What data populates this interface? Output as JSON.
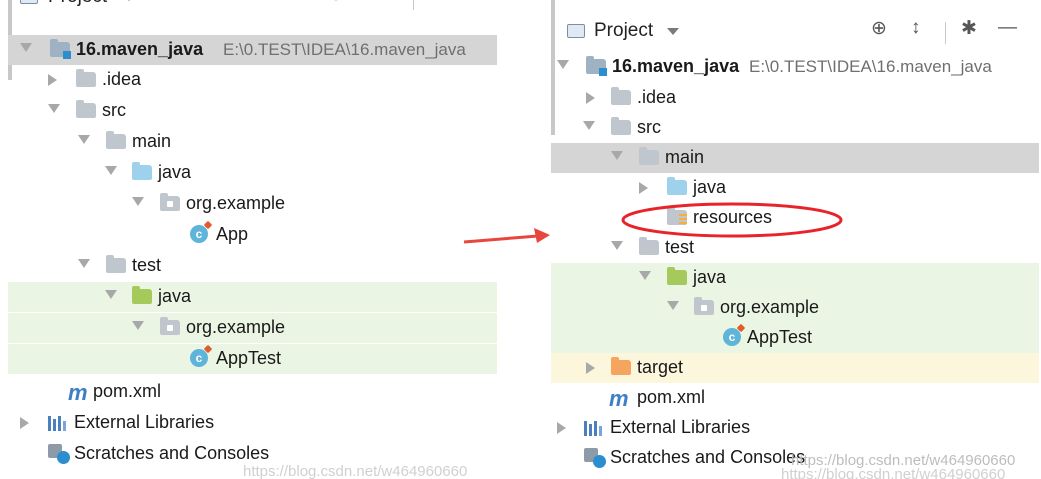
{
  "left_panel": {
    "header_title": "Project",
    "project_name": "16.maven_java",
    "project_path": "E:\\0.TEST\\IDEA\\16.maven_java",
    "items": [
      "16.maven_java",
      ".idea",
      "src",
      "main",
      "java",
      "org.example",
      "App",
      "test",
      "java",
      "org.example",
      "AppTest",
      "pom.xml",
      "External Libraries",
      "Scratches and Consoles"
    ],
    "watermark": "https://blog.csdn.net/w464960660"
  },
  "right_panel": {
    "header_title": "Project",
    "project_name": "16.maven_java",
    "project_path": "E:\\0.TEST\\IDEA\\16.maven_java",
    "items": [
      "16.maven_java",
      ".idea",
      "src",
      "main",
      "java",
      "resources",
      "test",
      "java",
      "org.example",
      "AppTest",
      "target",
      "pom.xml",
      "External Libraries",
      "Scratches and Consoles"
    ],
    "watermark": "https://blog.csdn.net/w464960660",
    "watermark2": "https://blog.csdn.net/w464960660"
  },
  "icons": {
    "header": "folder-icon",
    "locate": "crosshair-icon",
    "collapse": "collapse-all-icon",
    "settings": "gear-icon",
    "hide": "minus-icon",
    "module": "module-folder-icon",
    "folder": "folder-icon",
    "source": "source-folder-icon",
    "test_source": "test-source-folder-icon",
    "resources": "resources-folder-icon",
    "excluded": "excluded-folder-icon",
    "package": "package-icon",
    "class": "java-class-icon",
    "maven": "maven-icon",
    "libraries": "libraries-icon",
    "scratches": "scratches-icon"
  },
  "colors": {
    "selected_row": "#d5d5d5",
    "test_row": "#ebf5e4",
    "excluded_row": "#fbf6dc",
    "arrow": "#e8453c",
    "highlight_ellipse": "#e8232a"
  }
}
